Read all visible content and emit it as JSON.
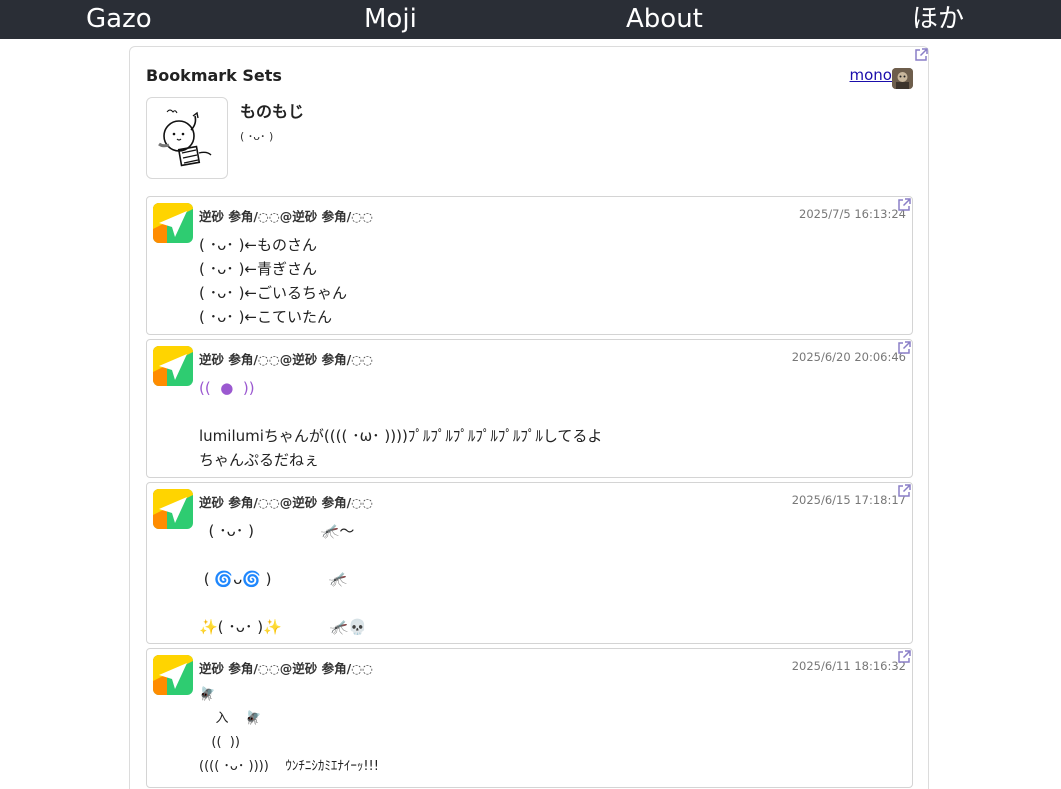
{
  "nav": {
    "items": [
      "Gazo",
      "Moji",
      "About",
      "ほか"
    ]
  },
  "bookmark_set": {
    "heading": "Bookmark Sets",
    "owner": "mono",
    "name": "ものもじ",
    "description": "( ･ᴗ･ )"
  },
  "posts": [
    {
      "author": "逆砂 参角/◌◌@逆砂 参角/◌◌",
      "time": "2025/7/5 16:13:24",
      "lines": [
        "( ･ᴗ･ )←ものさん",
        "( ･ᴗ･ )←青ぎさん",
        "( ･ᴗ･ )←ごいるちゃん",
        "( ･ᴗ･ )←こていたん"
      ]
    },
    {
      "author": "逆砂 参角/◌◌@逆砂 参角/◌◌",
      "time": "2025/6/20 20:06:46",
      "lines": [
        "((  ●  ))",
        "",
        "lumilumiちゃんが(((( ･ω･ ))))ﾌﾟﾙﾌﾟﾙﾌﾟﾙﾌﾟﾙﾌﾟﾙﾌﾟﾙしてるよ",
        "ちゃんぷるだねぇ"
      ]
    },
    {
      "author": "逆砂 参角/◌◌@逆砂 参角/◌◌",
      "time": "2025/6/15 17:18:17",
      "lines": [
        "  ( ･ᴗ･ )              🦟〜",
        "",
        " ( 🌀ᴗ🌀 )            🦟",
        "",
        "✨( ･ᴗ･ )✨          🦟💀"
      ]
    },
    {
      "author": "逆砂 参角/◌◌@逆砂 参角/◌◌",
      "time": "2025/6/11 18:16:32",
      "lines": [
        "🪰",
        "    入    🪰",
        "   ((  ))",
        "(((( ･ᴗ･ ))))    ｳﾝﾁﾆｼｶﾐｴﾅｲｰｯ!!!"
      ]
    }
  ],
  "colors": {
    "nav_bg": "#2a2e36",
    "link": "#1a0dab",
    "external_link_icon": "#8a7fc7"
  }
}
